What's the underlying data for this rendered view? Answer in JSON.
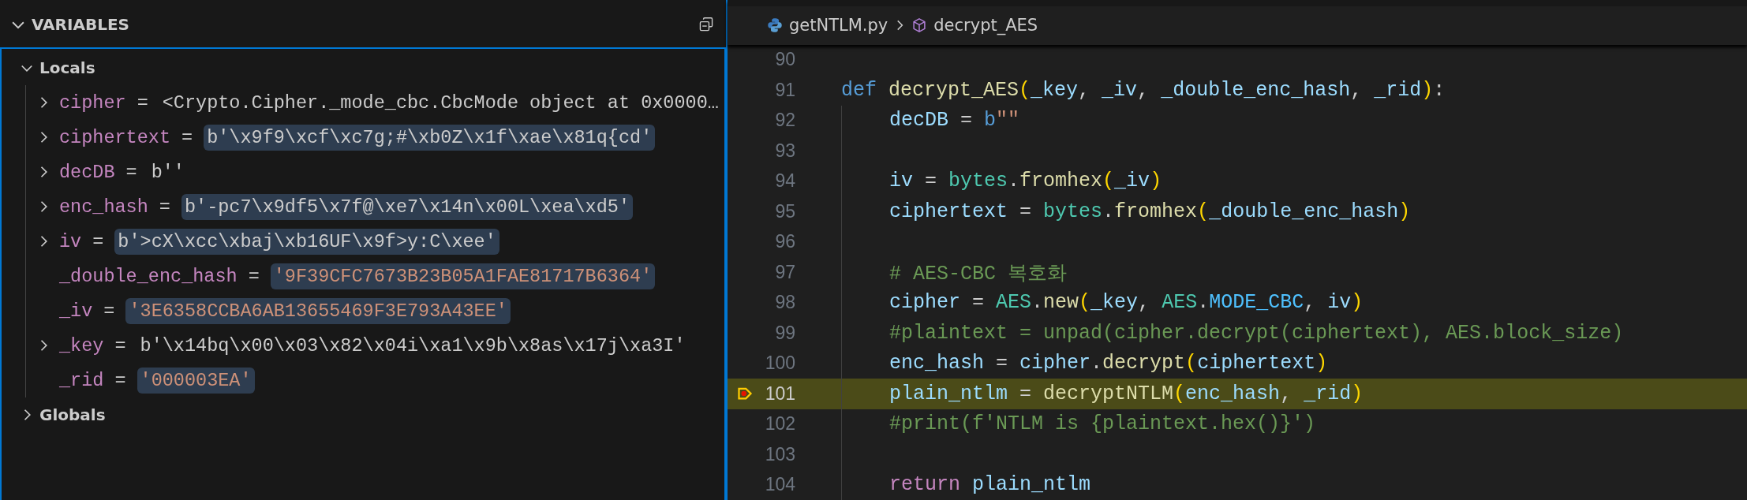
{
  "variables_panel": {
    "title": "VARIABLES",
    "scopes": [
      {
        "label": "Locals",
        "expanded": true,
        "children": [
          {
            "name": "cipher",
            "equals": "=",
            "value": "<Crypto.Cipher._mode_cbc.CbcMode object at 0x0000…",
            "kind": "object",
            "expandable": true,
            "highlighted": false
          },
          {
            "name": "ciphertext",
            "equals": "=",
            "value": "b'\\x9f9\\xcf\\xc7g;#\\xb0Z\\x1f\\xae\\x81q{cd'",
            "kind": "bytes",
            "expandable": true,
            "highlighted": true
          },
          {
            "name": "decDB",
            "equals": "=",
            "value": "b''",
            "kind": "bytes",
            "expandable": true,
            "highlighted": false
          },
          {
            "name": "enc_hash",
            "equals": "=",
            "value": "b'-pc7\\x9df5\\x7f@\\xe7\\x14n\\x00L\\xea\\xd5'",
            "kind": "bytes",
            "expandable": true,
            "highlighted": true
          },
          {
            "name": "iv",
            "equals": "=",
            "value": "b'>cX\\xcc\\xbaj\\xb16UF\\x9f>y:C\\xee'",
            "kind": "bytes",
            "expandable": true,
            "highlighted": true
          },
          {
            "name": "_double_enc_hash",
            "equals": "=",
            "value": "'9F39CFC7673B23B05A1FAE81717B6364'",
            "kind": "str",
            "expandable": false,
            "highlighted": true
          },
          {
            "name": "_iv",
            "equals": "=",
            "value": "'3E6358CCBA6AB13655469F3E793A43EE'",
            "kind": "str",
            "expandable": false,
            "highlighted": true
          },
          {
            "name": "_key",
            "equals": "=",
            "value": "b'\\x14bq\\x00\\x03\\x82\\x04i\\xa1\\x9b\\x8as\\x17j\\xa3I'",
            "kind": "bytes",
            "expandable": true,
            "highlighted": false
          },
          {
            "name": "_rid",
            "equals": "=",
            "value": "'000003EA'",
            "kind": "str",
            "expandable": false,
            "highlighted": true
          }
        ]
      },
      {
        "label": "Globals",
        "expanded": false
      }
    ]
  },
  "breadcrumbs": [
    {
      "label": "getNTLM.py",
      "kind": "file"
    },
    {
      "label": "decrypt_AES",
      "kind": "symbol"
    }
  ],
  "code": {
    "lines": [
      {
        "number": "90",
        "indented": false,
        "current": false
      },
      {
        "number": "91",
        "indented": false,
        "current": false,
        "tokens": [
          {
            "text": "def ",
            "kind": "keyword"
          },
          {
            "text": "decrypt_AES",
            "kind": "function"
          },
          {
            "text": "(",
            "kind": "bracket"
          },
          {
            "text": "_key",
            "kind": "variable"
          },
          {
            "text": ", ",
            "kind": "plain"
          },
          {
            "text": "_iv",
            "kind": "variable"
          },
          {
            "text": ", ",
            "kind": "plain"
          },
          {
            "text": "_double_enc_hash",
            "kind": "variable"
          },
          {
            "text": ", ",
            "kind": "plain"
          },
          {
            "text": "_rid",
            "kind": "variable"
          },
          {
            "text": ")",
            "kind": "bracket"
          },
          {
            "text": ":",
            "kind": "plain"
          }
        ]
      },
      {
        "number": "92",
        "indented": true,
        "current": false,
        "tokens": [
          {
            "text": "decDB",
            "kind": "variable"
          },
          {
            "text": " = ",
            "kind": "plain"
          },
          {
            "text": "b",
            "kind": "keyword"
          },
          {
            "text": "\"\"",
            "kind": "string"
          }
        ]
      },
      {
        "number": "93",
        "indented": true,
        "current": false
      },
      {
        "number": "94",
        "indented": true,
        "current": false,
        "tokens": [
          {
            "text": "iv",
            "kind": "variable"
          },
          {
            "text": " = ",
            "kind": "plain"
          },
          {
            "text": "bytes",
            "kind": "class"
          },
          {
            "text": ".",
            "kind": "plain"
          },
          {
            "text": "fromhex",
            "kind": "function"
          },
          {
            "text": "(",
            "kind": "bracket"
          },
          {
            "text": "_iv",
            "kind": "variable"
          },
          {
            "text": ")",
            "kind": "bracket"
          }
        ]
      },
      {
        "number": "95",
        "indented": true,
        "current": false,
        "tokens": [
          {
            "text": "ciphertext",
            "kind": "variable"
          },
          {
            "text": " = ",
            "kind": "plain"
          },
          {
            "text": "bytes",
            "kind": "class"
          },
          {
            "text": ".",
            "kind": "plain"
          },
          {
            "text": "fromhex",
            "kind": "function"
          },
          {
            "text": "(",
            "kind": "bracket"
          },
          {
            "text": "_double_enc_hash",
            "kind": "variable"
          },
          {
            "text": ")",
            "kind": "bracket"
          }
        ]
      },
      {
        "number": "96",
        "indented": true,
        "current": false
      },
      {
        "number": "97",
        "indented": true,
        "current": false,
        "tokens": [
          {
            "text": "# AES-CBC 복호화",
            "kind": "comment"
          }
        ]
      },
      {
        "number": "98",
        "indented": true,
        "current": false,
        "tokens": [
          {
            "text": "cipher",
            "kind": "variable"
          },
          {
            "text": " = ",
            "kind": "plain"
          },
          {
            "text": "AES",
            "kind": "class"
          },
          {
            "text": ".",
            "kind": "plain"
          },
          {
            "text": "new",
            "kind": "function"
          },
          {
            "text": "(",
            "kind": "bracket"
          },
          {
            "text": "_key",
            "kind": "variable"
          },
          {
            "text": ", ",
            "kind": "plain"
          },
          {
            "text": "AES",
            "kind": "class"
          },
          {
            "text": ".",
            "kind": "plain"
          },
          {
            "text": "MODE_CBC",
            "kind": "constant"
          },
          {
            "text": ", ",
            "kind": "plain"
          },
          {
            "text": "iv",
            "kind": "variable"
          },
          {
            "text": ")",
            "kind": "bracket"
          }
        ]
      },
      {
        "number": "99",
        "indented": true,
        "current": false,
        "tokens": [
          {
            "text": "#plaintext = unpad(cipher.decrypt(ciphertext), AES.block_size)",
            "kind": "comment"
          }
        ]
      },
      {
        "number": "100",
        "indented": true,
        "current": false,
        "tokens": [
          {
            "text": "enc_hash",
            "kind": "variable"
          },
          {
            "text": " = ",
            "kind": "plain"
          },
          {
            "text": "cipher",
            "kind": "variable"
          },
          {
            "text": ".",
            "kind": "plain"
          },
          {
            "text": "decrypt",
            "kind": "function"
          },
          {
            "text": "(",
            "kind": "bracket"
          },
          {
            "text": "ciphertext",
            "kind": "variable"
          },
          {
            "text": ")",
            "kind": "bracket"
          }
        ]
      },
      {
        "number": "101",
        "indented": true,
        "current": true,
        "tokens": [
          {
            "text": "plain_ntlm",
            "kind": "variable"
          },
          {
            "text": " = ",
            "kind": "plain"
          },
          {
            "text": "decryptNTLM",
            "kind": "function"
          },
          {
            "text": "(",
            "kind": "bracket"
          },
          {
            "text": "enc_hash",
            "kind": "variable"
          },
          {
            "text": ", ",
            "kind": "plain"
          },
          {
            "text": "_rid",
            "kind": "variable"
          },
          {
            "text": ")",
            "kind": "bracket"
          }
        ]
      },
      {
        "number": "102",
        "indented": true,
        "current": false,
        "tokens": [
          {
            "text": "#print(f'NTLM is {plaintext.hex()}')",
            "kind": "comment"
          }
        ]
      },
      {
        "number": "103",
        "indented": true,
        "current": false
      },
      {
        "number": "104",
        "indented": true,
        "current": false,
        "tokens": [
          {
            "text": "return ",
            "kind": "control"
          },
          {
            "text": "plain_ntlm",
            "kind": "variable"
          }
        ]
      }
    ]
  }
}
